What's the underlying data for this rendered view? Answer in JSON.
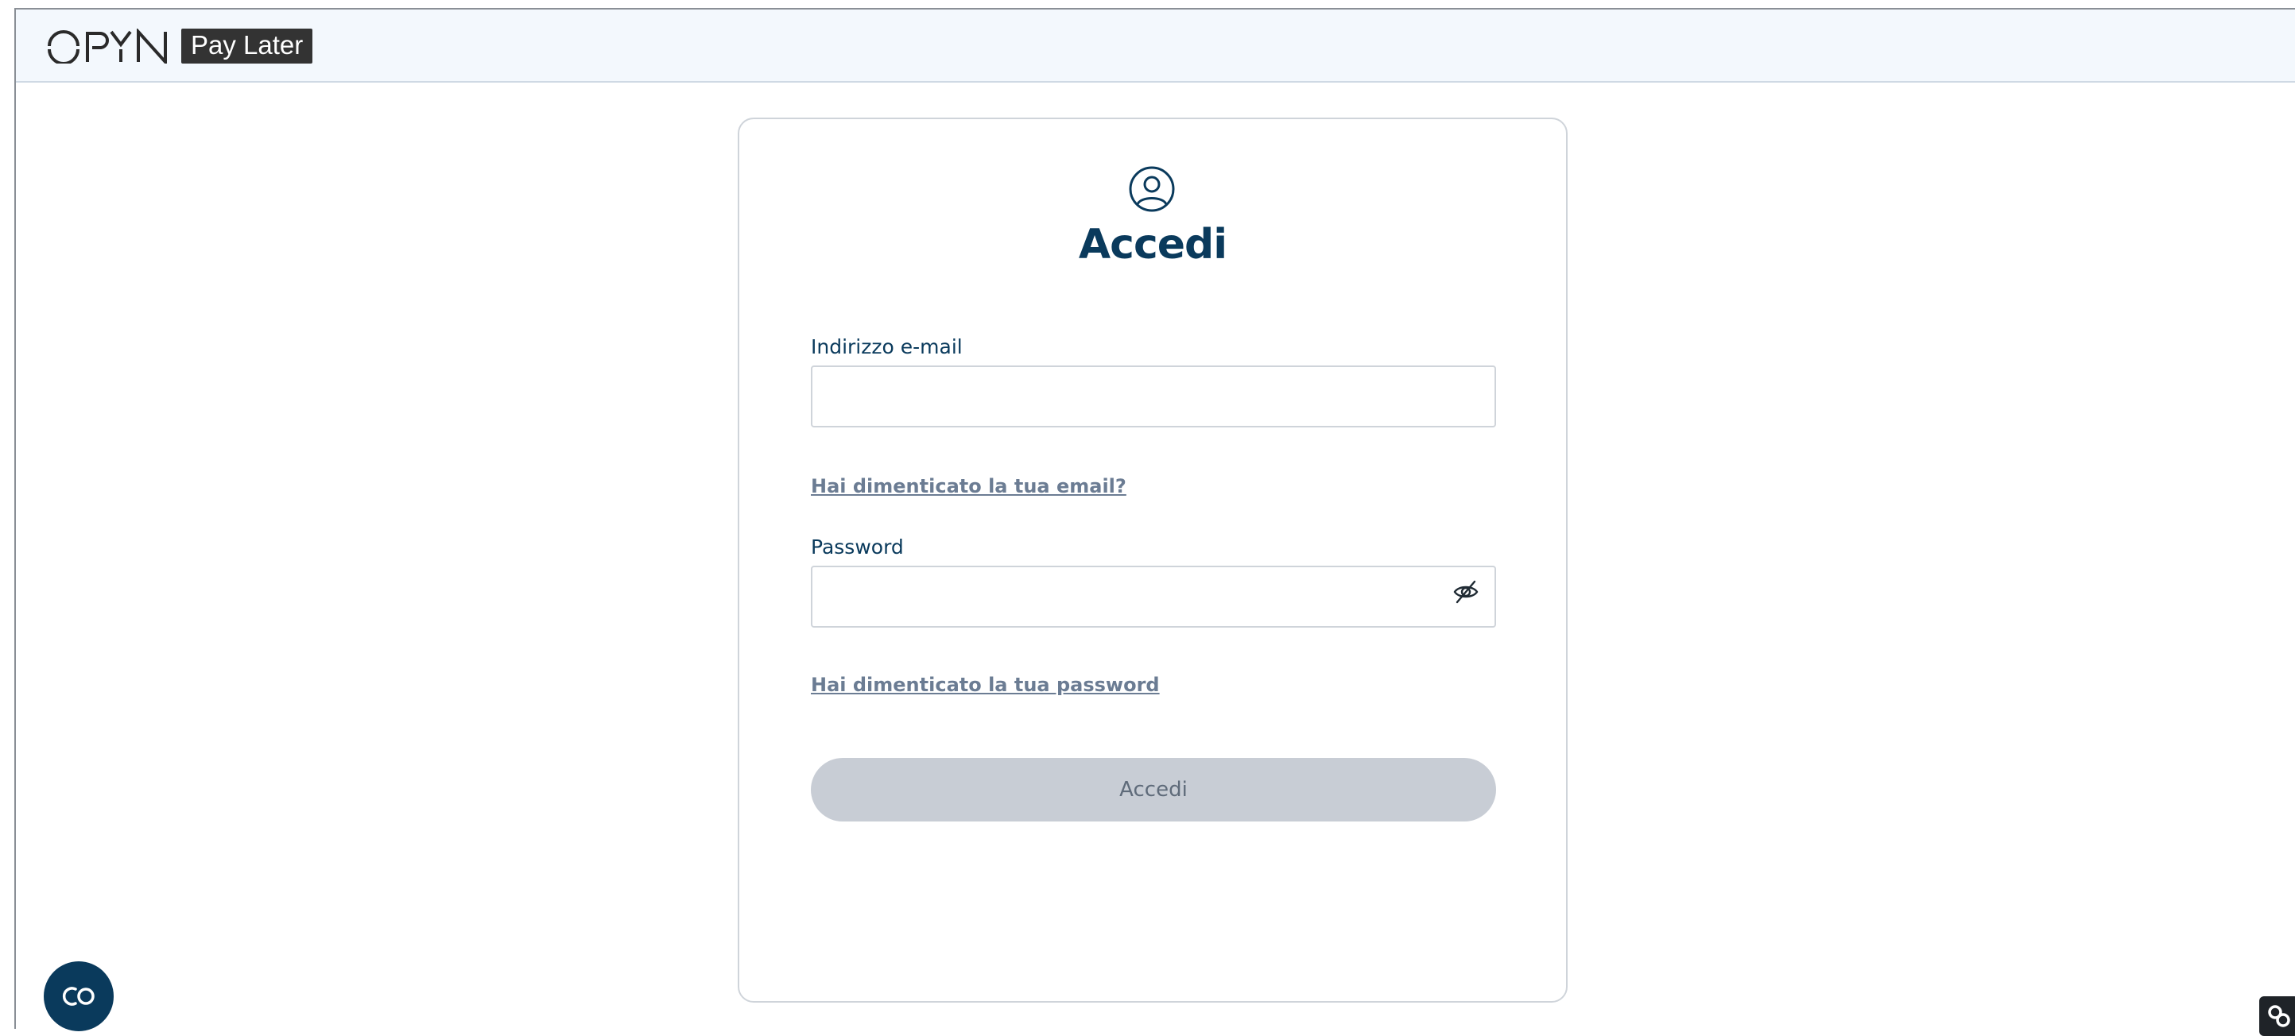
{
  "header": {
    "logo_badge": "Pay Later",
    "logo_icon": "opyn-logo"
  },
  "login": {
    "icon": "user-circle-icon",
    "title": "Accedi",
    "email_label": "Indirizzo e-mail",
    "email_value": "",
    "forgot_email": "Hai dimenticato la tua email?",
    "password_label": "Password",
    "password_value": "",
    "password_toggle_icon": "eye-off-icon",
    "forgot_password": "Hai dimenticato la tua password",
    "submit_label": "Accedi"
  },
  "widgets": {
    "chat_icon": "chat-bubble-icon",
    "corner_icon": "link-icon"
  },
  "colors": {
    "primary": "#0a3a5c",
    "header_bg": "#f3f8fd",
    "button_disabled_bg": "#c8cdd5",
    "link": "#6b7c93"
  }
}
